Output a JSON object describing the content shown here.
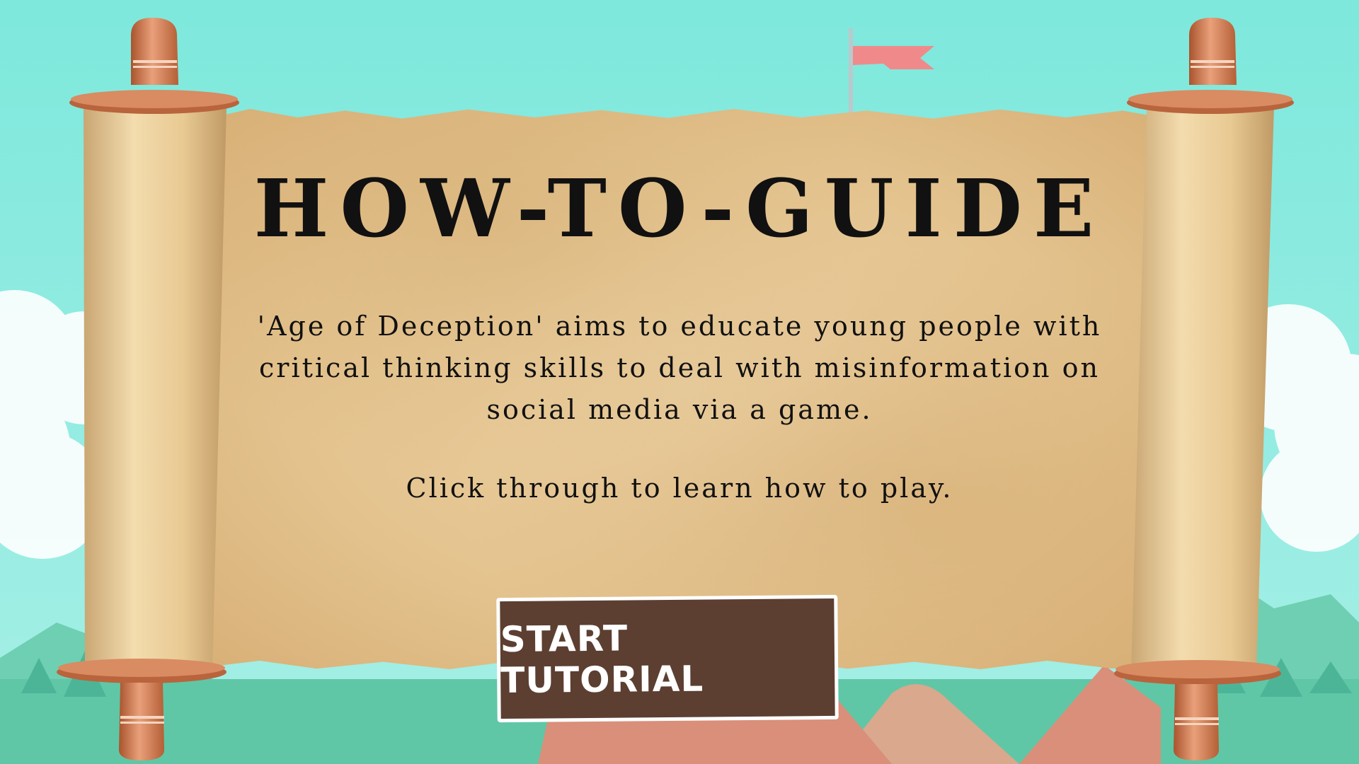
{
  "guide": {
    "title": "HOW-TO-GUIDE",
    "description": "'Age of Deception' aims to educate young people with critical thinking skills to deal with misinformation on social media via a game.",
    "instruction": "Click through to learn how to play.",
    "start_button_label": "START TUTORIAL"
  },
  "colors": {
    "sky": "#7fe9dd",
    "parchment": "#e6c892",
    "roller_wood": "#c8744a",
    "button_bg": "#5c3f31",
    "button_text": "#ffffff",
    "flag": "#f08a8a"
  },
  "icons": {
    "flag": "castle-flag-icon",
    "scroll": "parchment-scroll"
  }
}
